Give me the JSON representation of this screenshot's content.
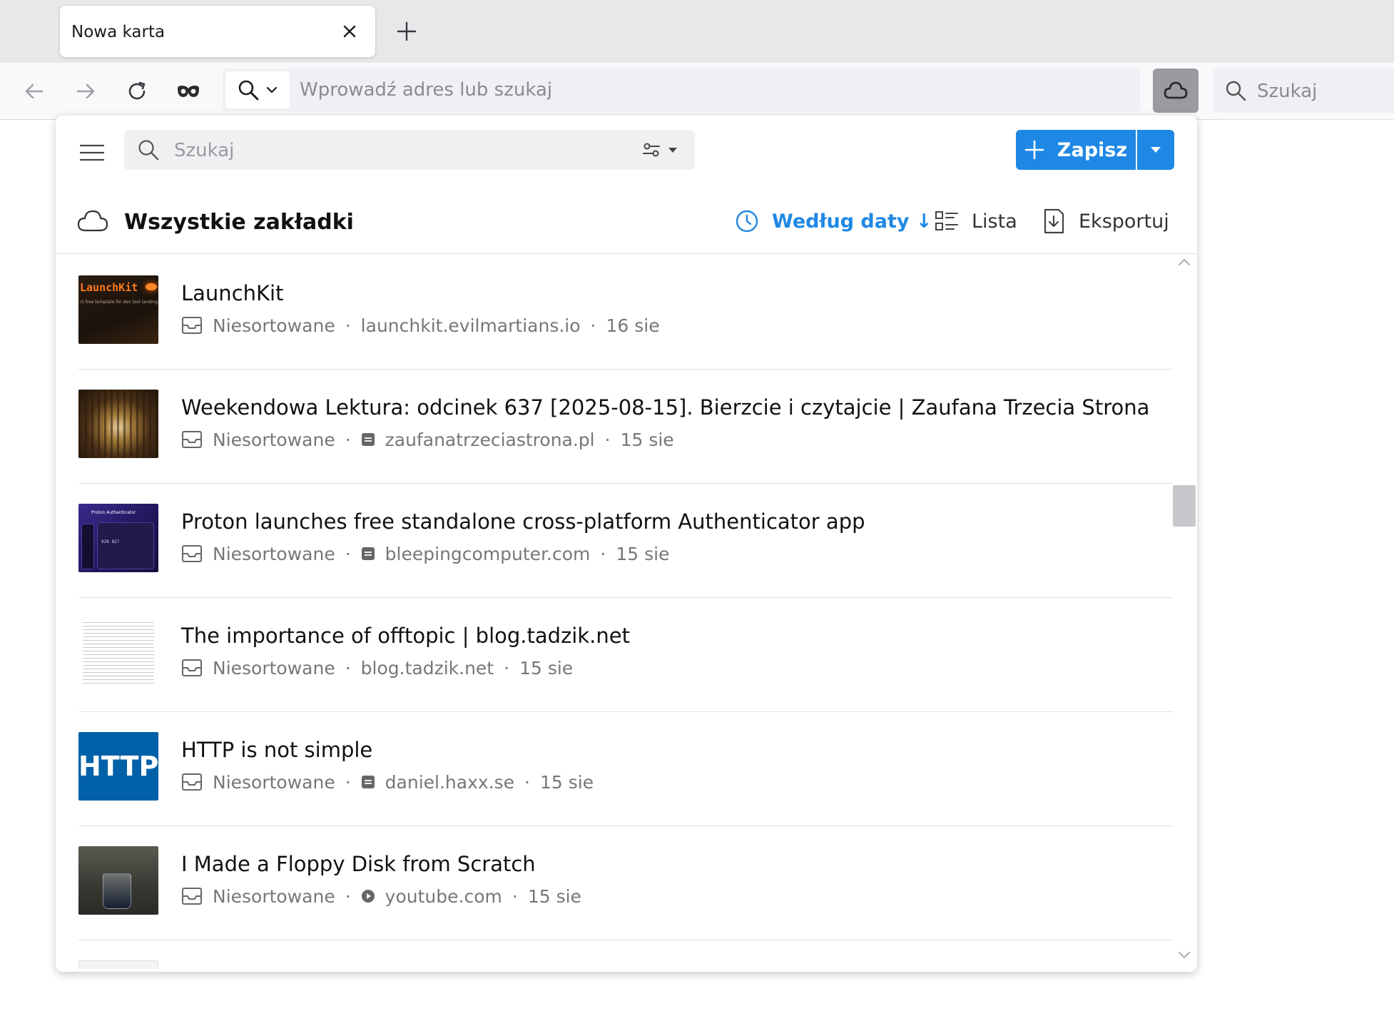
{
  "tab": {
    "title": "Nowa karta"
  },
  "urlbar": {
    "placeholder": "Wprowadź adres lub szukaj"
  },
  "browser_search": {
    "placeholder": "Szukaj"
  },
  "popup": {
    "search_placeholder": "Szukaj",
    "save_label": "Zapisz",
    "collection_title": "Wszystkie zakładki",
    "sort_label": "Według daty ↓",
    "view_label": "Lista",
    "export_label": "Eksportuj",
    "accent_color": "#1f88e5"
  },
  "items": [
    {
      "title": "LaunchKit",
      "collection": "Niesortowane",
      "domain": "launchkit.evilmartians.io",
      "date": "16 sie",
      "type_icon": "none",
      "thumb": {
        "text": "LaunchKit",
        "subtext": "ct free template for dev tool landing"
      }
    },
    {
      "title": "Weekendowa Lektura: odcinek 637 [2025-08-15]. Bierzcie i czytajcie | Zaufana Trzecia Strona",
      "collection": "Niesortowane",
      "domain": "zaufanatrzeciastrona.pl",
      "date": "15 sie",
      "type_icon": "article-icon"
    },
    {
      "title": "Proton launches free standalone cross-platform Authenticator app",
      "collection": "Niesortowane",
      "domain": "bleepingcomputer.com",
      "date": "15 sie",
      "type_icon": "article-icon",
      "thumb": {
        "text": "Proton Authenticator",
        "subtext": "928 827"
      }
    },
    {
      "title": "The importance of offtopic | blog.tadzik.net",
      "collection": "Niesortowane",
      "domain": "blog.tadzik.net",
      "date": "15 sie",
      "type_icon": "none"
    },
    {
      "title": "HTTP is not simple",
      "collection": "Niesortowane",
      "domain": "daniel.haxx.se",
      "date": "15 sie",
      "type_icon": "article-icon",
      "thumb": {
        "text": "HTTP"
      }
    },
    {
      "title": "I Made a Floppy Disk from Scratch",
      "collection": "Niesortowane",
      "domain": "youtube.com",
      "date": "15 sie",
      "type_icon": "video-icon"
    }
  ]
}
